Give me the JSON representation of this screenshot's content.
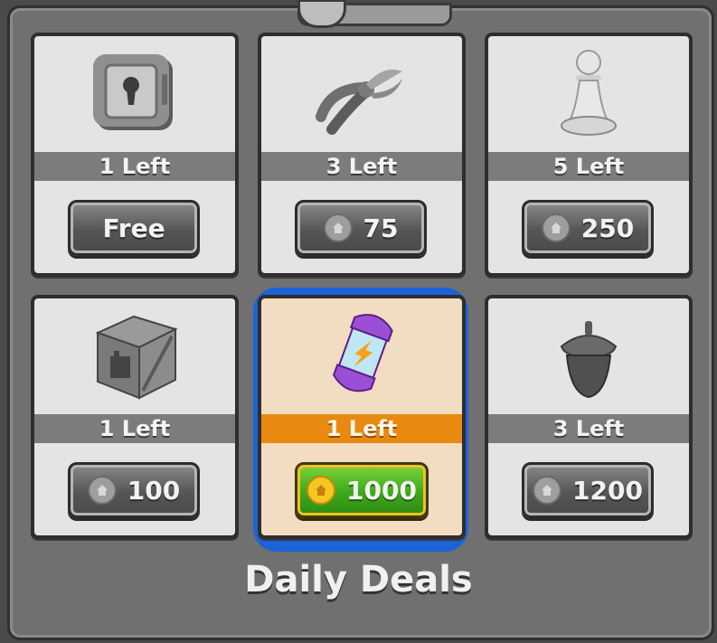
{
  "title": "Daily Deals",
  "deals": [
    {
      "item": "safe-icon",
      "stock": "1 Left",
      "price": "Free",
      "has_coin": false,
      "highlighted": false
    },
    {
      "item": "pliers-icon",
      "stock": "3 Left",
      "price": "75",
      "has_coin": true,
      "highlighted": false
    },
    {
      "item": "pawn-icon",
      "stock": "5 Left",
      "price": "250",
      "has_coin": true,
      "highlighted": false
    },
    {
      "item": "crate-icon",
      "stock": "1 Left",
      "price": "100",
      "has_coin": true,
      "highlighted": false
    },
    {
      "item": "energy-capsule-icon",
      "stock": "1 Left",
      "price": "1000",
      "has_coin": true,
      "highlighted": true
    },
    {
      "item": "acorn-icon",
      "stock": "3 Left",
      "price": "1200",
      "has_coin": true,
      "highlighted": false
    }
  ],
  "colors": {
    "highlight_card": "#f2dcc2",
    "highlight_ribbon": "#e98a10",
    "highlight_button": "#3ea81c",
    "selection_glow": "#1a63d8",
    "coin_gold": "#f7c623"
  }
}
